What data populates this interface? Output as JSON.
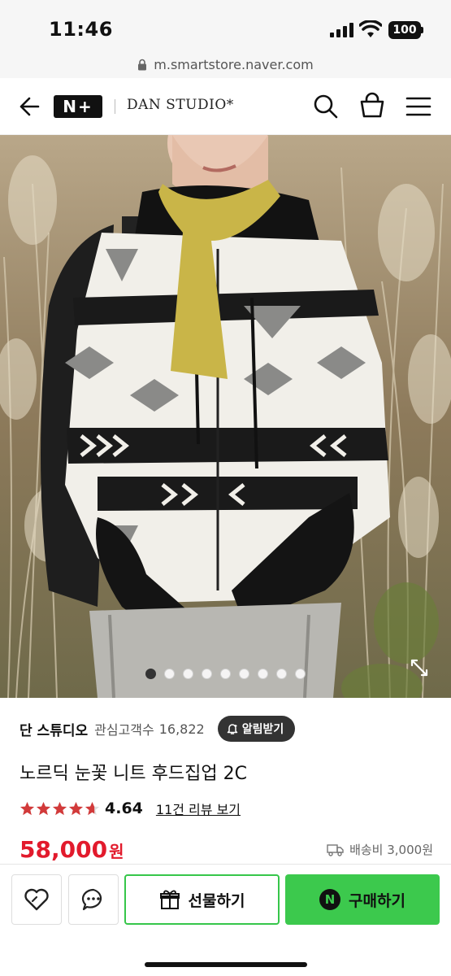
{
  "status_bar": {
    "time": "11:46",
    "battery": "100"
  },
  "url_bar": {
    "url": "m.smartstore.naver.com"
  },
  "nav": {
    "platform_logo": "N+",
    "brand": "DAN STUDIO*"
  },
  "gallery": {
    "total_images": 9,
    "active_index": 0
  },
  "product": {
    "store_name": "단 스튜디오",
    "followers_label": "관심고객수",
    "followers_count": "16,822",
    "notify_label": "알림받기",
    "title": "노르딕 눈꽃 니트 후드집업 2C",
    "rating": "4.64",
    "reviews_link": "11건 리뷰 보기",
    "price": "58,000",
    "price_unit": "원",
    "shipping": "배송비 3,000원"
  },
  "bottom_bar": {
    "gift_label": "선물하기",
    "buy_label": "구매하기",
    "n_badge": "N"
  },
  "colors": {
    "price_red": "#e21a2c",
    "naver_green": "#3cc94d",
    "star_red": "#d23a3a"
  },
  "icons": [
    "back-icon",
    "search-icon",
    "cart-icon",
    "menu-icon",
    "lock-icon",
    "expand-icon",
    "bell-icon",
    "star-icon",
    "truck-icon",
    "heart-icon",
    "talk-icon",
    "gift-icon"
  ]
}
